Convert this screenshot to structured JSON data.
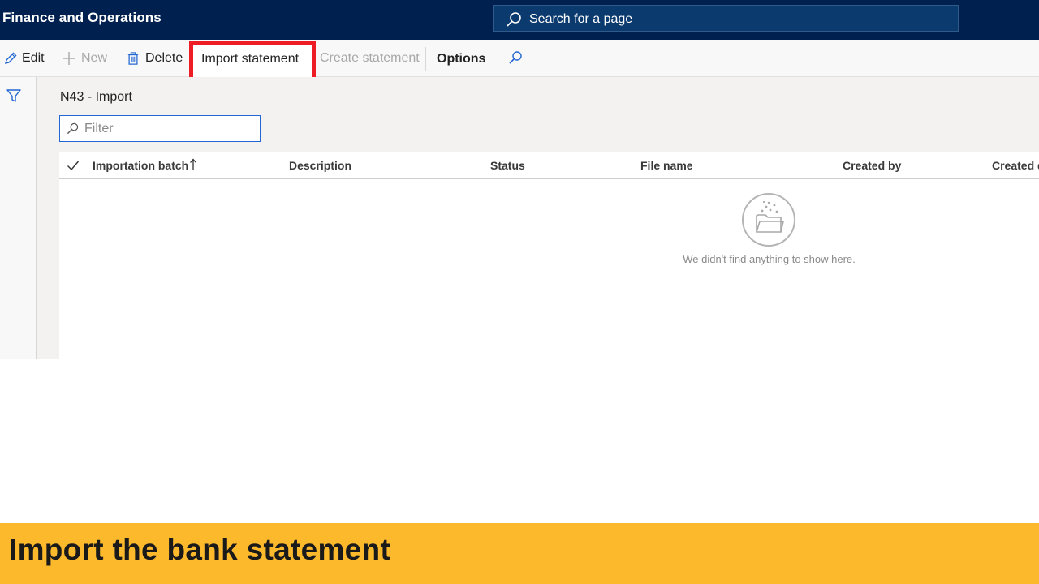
{
  "app": {
    "title": "Finance and Operations"
  },
  "search": {
    "label": "Search for a page",
    "icon": "search-icon"
  },
  "actions": {
    "edit": "Edit",
    "new": "New",
    "delete": "Delete",
    "import_statement": "Import statement",
    "create_statement": "Create statement",
    "options": "Options"
  },
  "page": {
    "title": "N43 - Import"
  },
  "filter": {
    "placeholder": "Filter",
    "value": ""
  },
  "grid": {
    "columns": [
      "Importation batch",
      "Description",
      "Status",
      "File name",
      "Created by",
      "Created d"
    ],
    "sort_column": "Importation batch",
    "empty_message": "We didn't find anything to show here."
  },
  "caption": {
    "text": "Import the bank statement"
  },
  "colors": {
    "topbar": "#002050",
    "accent": "#2266d1",
    "highlight": "#ee1c25",
    "caption_band": "#fdb92c"
  }
}
